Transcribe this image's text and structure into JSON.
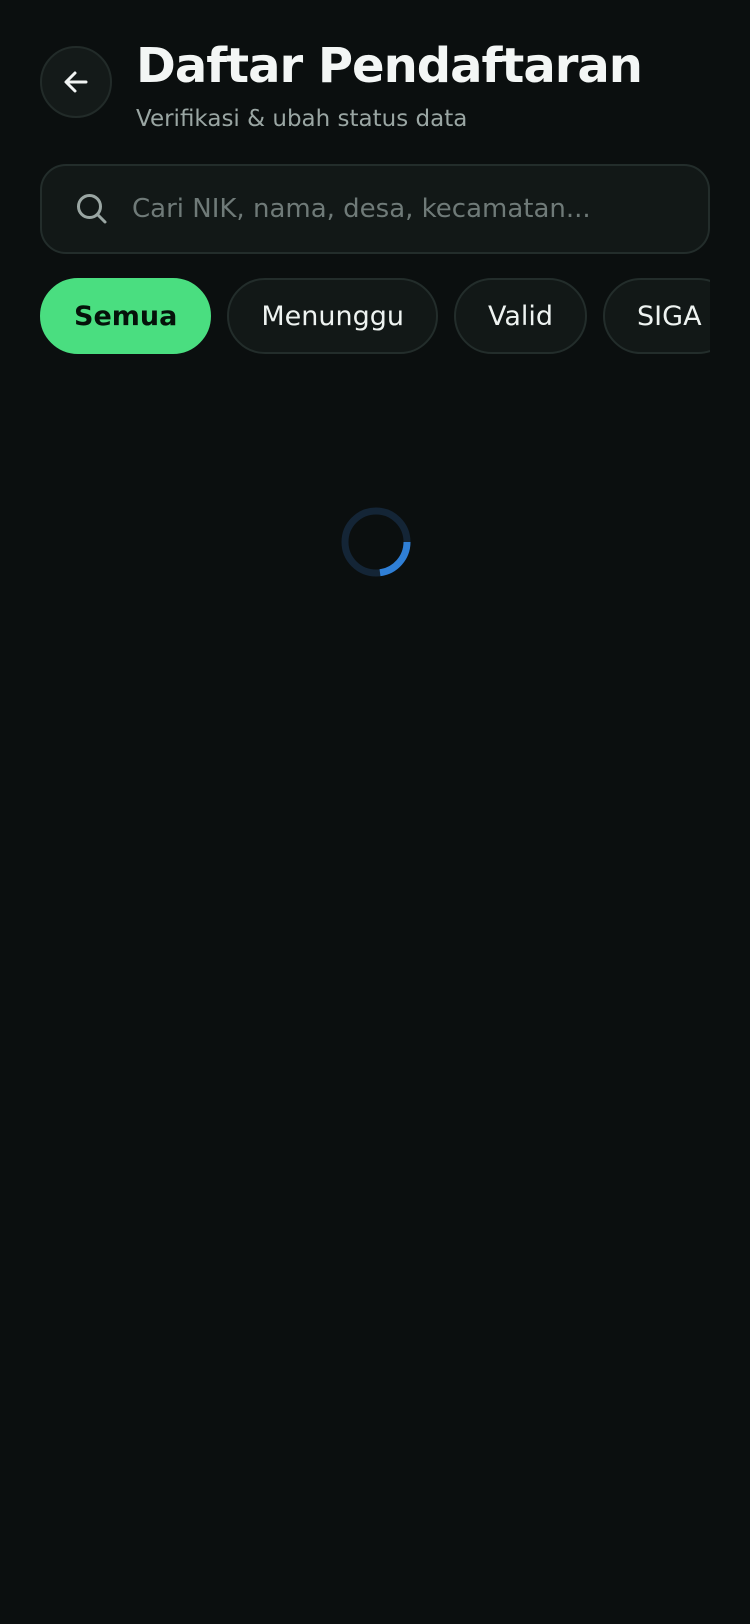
{
  "header": {
    "title": "Daftar Pendaftaran",
    "subtitle": "Verifikasi & ubah status data",
    "back_icon": "arrow-left-icon"
  },
  "search": {
    "value": "",
    "placeholder": "Cari NIK, nama, desa, kecamatan...",
    "icon": "search-icon"
  },
  "filters": {
    "selected": "Semua",
    "items": [
      {
        "label": "Semua"
      },
      {
        "label": "Menunggu"
      },
      {
        "label": "Valid"
      },
      {
        "label": "SIGA"
      }
    ]
  },
  "loading": {
    "icon": "loading-spinner-icon"
  },
  "colors": {
    "background": "#0b0f0f",
    "surface": "#121817",
    "border": "#232d2b",
    "accent": "#4ade80",
    "spinner": "#2f7fd6",
    "text_primary": "#f3f6f5",
    "text_secondary": "#9aa6a3",
    "placeholder": "#6f7a78"
  }
}
